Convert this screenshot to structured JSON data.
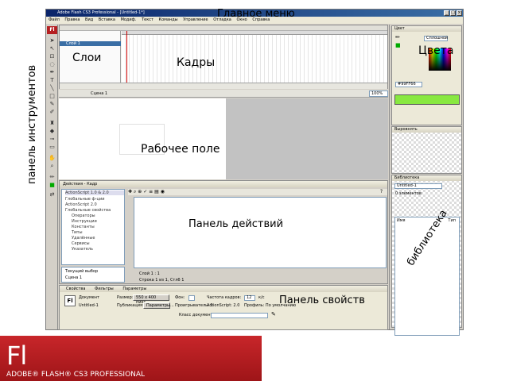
{
  "window": {
    "title": "Adobe Flash CS3 Professional - [Untitled-1*]",
    "menu": [
      "Файл",
      "Правка",
      "Вид",
      "Вставка",
      "Модиф.",
      "Текст",
      "Команды",
      "Управление",
      "Отладка",
      "Окно",
      "Справка"
    ]
  },
  "annotations": {
    "main_menu": "Главное меню",
    "layers": "Слои",
    "frames": "Кадры",
    "colors": "Цвета",
    "toolbox": "панель инструментов",
    "stage": "Рабочее поле",
    "actions": "Панель действий",
    "properties": "Панель свойств",
    "library": "библиотека"
  },
  "timeline": {
    "layer_name": "Слой 1"
  },
  "edit_bar": {
    "scene": "Сцена 1",
    "zoom": "100%"
  },
  "actions_panel": {
    "header": "Действия - Кадр",
    "target": "ActionScript 1.0 & 2.0",
    "tree": [
      "Глобальные ф-ции",
      "ActionScript 2.0",
      "Глобальные свойства",
      "Операторы",
      "Инструкции",
      "Константы",
      "Типы",
      "Удалённые",
      "Сервисы",
      "Указатель",
      "Текущий выбор",
      "Сцена 1"
    ],
    "status": "Строка 1 из 1, Стлб 1",
    "layer_tab": "Слой 1 : 1"
  },
  "properties_panel": {
    "tabs": [
      "Свойства",
      "Фильтры",
      "Параметры"
    ],
    "doc_label": "Документ",
    "doc_name": "Untitled-1",
    "size_label": "Размер:",
    "size_value": "550 x 400 пикс.",
    "bg_label": "Фон:",
    "fps_label": "Частота кадров:",
    "fps_value": "12",
    "fps_unit": "к/с",
    "publish_label": "Публикация:",
    "settings_button": "Параметры...",
    "player_label": "Проигрыватель: 9",
    "actionscript_label": "ActionScript: 2.0",
    "profile_label": "Профиль: По умолчанию",
    "class_label": "Класс документа:"
  },
  "right_panels": {
    "color_header": "Цвет",
    "color_mode": "Сплошной",
    "hex_value": "#99FF66",
    "align_header": "Выровнять",
    "library_header": "Библиотека",
    "library_doc": "Untitled-1",
    "library_count": "0 элементов",
    "library_col_name": "Имя",
    "library_col_type": "Тип"
  },
  "branding": {
    "logo_letters": "Fl",
    "product": "ADOBE® FLASH® CS3 PROFESSIONAL"
  }
}
